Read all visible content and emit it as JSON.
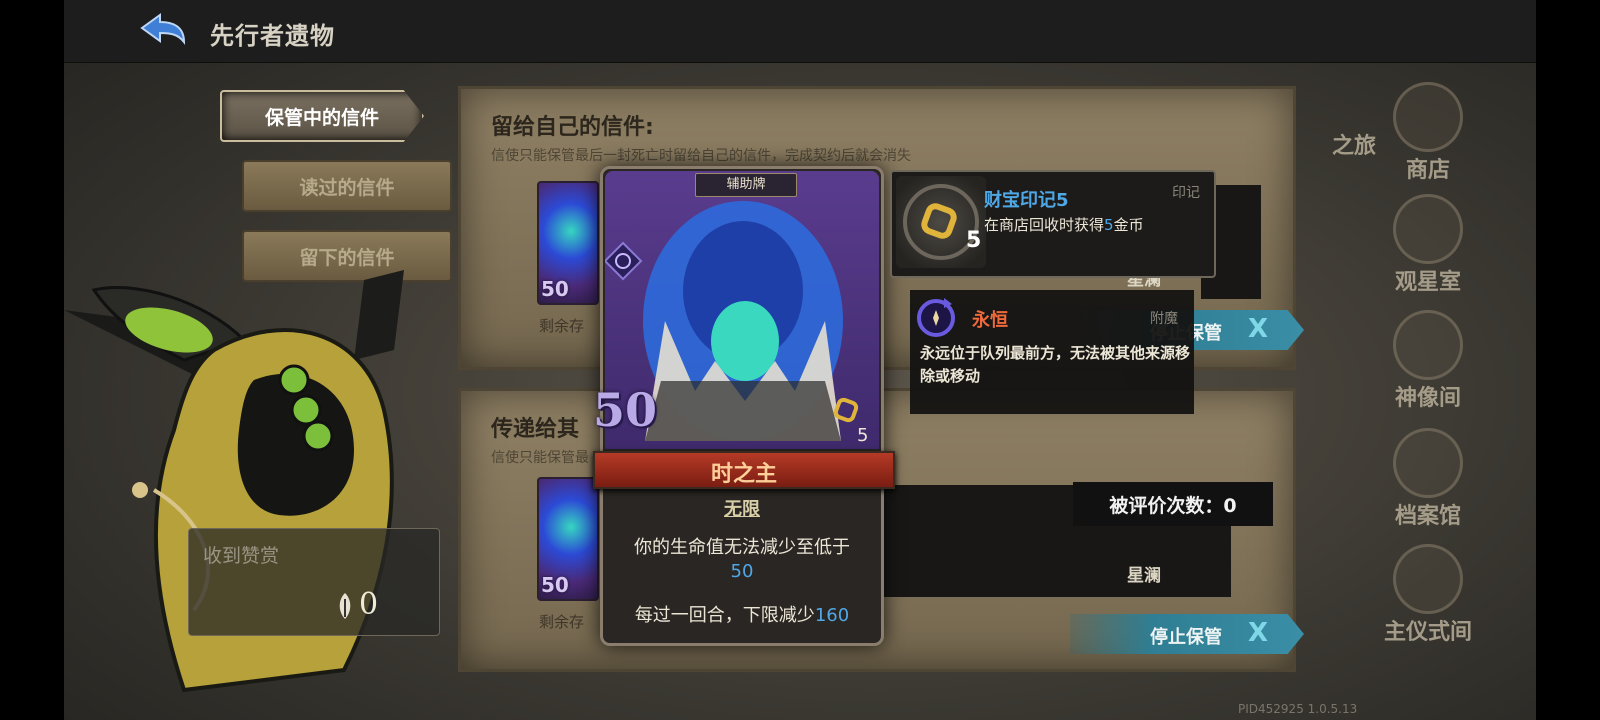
{
  "header": {
    "title": "先行者遗物"
  },
  "nav": {
    "tabs": [
      {
        "label": "保管中的信件",
        "active": true
      },
      {
        "label": "读过的信件",
        "active": false
      },
      {
        "label": "留下的信件",
        "active": false
      }
    ]
  },
  "reward": {
    "label": "收到赞赏",
    "count": "0"
  },
  "panel_self": {
    "title": "留给自己的信件:",
    "desc": "信使只能保管最后一封死亡时留给自己的信件，完成契约后就会消失",
    "remain": "剩余存",
    "card_cost": "50",
    "sender": "星澜",
    "stop_label": "停止保管",
    "stop_x": "X"
  },
  "panel_others": {
    "title": "传递给其",
    "desc": "信使只能保管最",
    "remain": "剩余存",
    "card_cost": "50",
    "sender": "星澜",
    "stop_label": "停止保管",
    "stop_x": "X"
  },
  "rating": {
    "text": "被评价次数：0"
  },
  "right_menu": {
    "journey_partial": "之旅",
    "items": [
      "商店",
      "观星室",
      "神像间",
      "档案馆",
      "主仪式间"
    ]
  },
  "card": {
    "type": "辅助牌",
    "cost": "50",
    "gold": "5",
    "name": "时之主",
    "keyword": "无限",
    "desc1": "你的生命值无法减少至低于",
    "desc1_value": "50",
    "desc2": "每过一回合，下限减少",
    "desc2_value": "160"
  },
  "seal_tooltip": {
    "name": "财宝印记5",
    "type": "印记",
    "number": "5",
    "desc_before": "在商店回收时获得",
    "desc_value": "5",
    "desc_after": "金币"
  },
  "enchant_tooltip": {
    "name": "永恒",
    "type": "附魔",
    "desc": "永远位于队列最前方，无法被其他来源移除或移动"
  },
  "version": "PID452925  1.0.5.13",
  "colors": {
    "accent_blue": "#4fa8e6",
    "enchant_orange": "#ef6a3a",
    "stop_teal": "#2f7e93"
  }
}
